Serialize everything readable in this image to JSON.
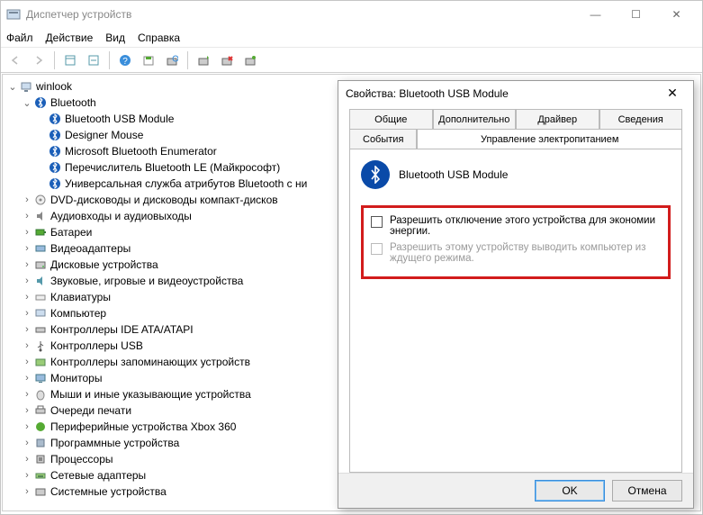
{
  "window": {
    "title": "Диспетчер устройств"
  },
  "menu": {
    "file": "Файл",
    "action": "Действие",
    "view": "Вид",
    "help": "Справка"
  },
  "tree": {
    "root": "winlook",
    "bluetooth": "Bluetooth",
    "bt_children": [
      "Bluetooth USB Module",
      "Designer Mouse",
      "Microsoft Bluetooth Enumerator",
      "Перечислитель Bluetooth LE (Майкрософт)",
      "Универсальная служба атрибутов Bluetooth с ни"
    ],
    "others": [
      "DVD-дисководы и дисководы компакт-дисков",
      "Аудиовходы и аудиовыходы",
      "Батареи",
      "Видеоадаптеры",
      "Дисковые устройства",
      "Звуковые, игровые и видеоустройства",
      "Клавиатуры",
      "Компьютер",
      "Контроллеры IDE ATA/ATAPI",
      "Контроллеры USB",
      "Контроллеры запоминающих устройств",
      "Мониторы",
      "Мыши и иные указывающие устройства",
      "Очереди печати",
      "Периферийные устройства Xbox 360",
      "Программные устройства",
      "Процессоры",
      "Сетевые адаптеры",
      "Системные устройства"
    ]
  },
  "dialog": {
    "title": "Свойства: Bluetooth USB Module",
    "tabs_row1": [
      "Общие",
      "Дополнительно",
      "Драйвер",
      "Сведения"
    ],
    "tabs_row2": [
      "События",
      "Управление электропитанием"
    ],
    "device_name": "Bluetooth USB Module",
    "checkbox1": "Разрешить отключение этого устройства для экономии энергии.",
    "checkbox2": "Разрешить этому устройству выводить компьютер из ждущего режима.",
    "ok": "OK",
    "cancel": "Отмена"
  }
}
